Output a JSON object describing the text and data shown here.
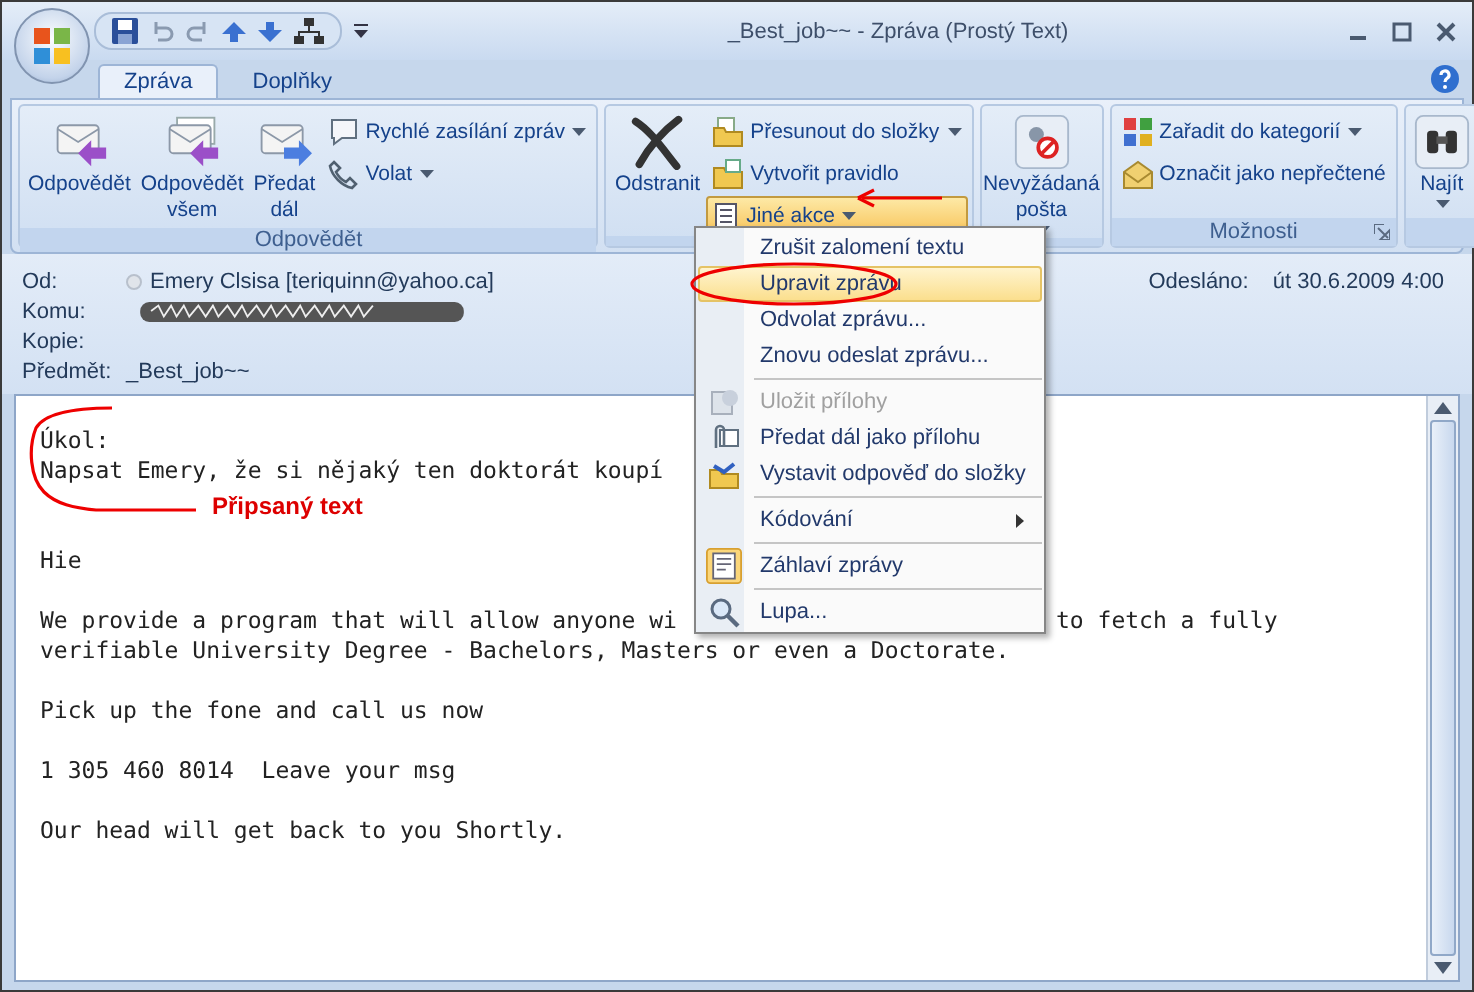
{
  "window": {
    "title": "_Best_job~~ - Zpráva (Prostý Text)"
  },
  "tabs": [
    {
      "label": "Zpráva",
      "selected": true
    },
    {
      "label": "Doplňky",
      "selected": false
    }
  ],
  "ribbon": {
    "groups": [
      {
        "label": "Odpovědět",
        "buttons": [
          {
            "label": "Odpovědět",
            "kind": "large",
            "dropdown": false,
            "pressed": false
          },
          {
            "label": "Odpovědět všem",
            "kind": "large",
            "dropdown": false,
            "pressed": false
          },
          {
            "label": "Předat dál",
            "kind": "large",
            "dropdown": false,
            "pressed": false
          },
          {
            "label": "Rychlé zasílání zpráv",
            "kind": "small",
            "dropdown": true,
            "pressed": false
          },
          {
            "label": "Volat",
            "kind": "small",
            "dropdown": true,
            "pressed": false
          }
        ]
      },
      {
        "buttons": [
          {
            "label": "Odstranit",
            "kind": "large",
            "dropdown": false,
            "pressed": false
          },
          {
            "label": "Přesunout do složky",
            "kind": "small",
            "dropdown": true,
            "pressed": false
          },
          {
            "label": "Vytvořit pravidlo",
            "kind": "small",
            "dropdown": false,
            "pressed": false
          },
          {
            "label": "Jiné akce",
            "kind": "small",
            "dropdown": true,
            "pressed": true
          }
        ]
      },
      {
        "buttons": [
          {
            "label": "Nevyžádaná pošta",
            "kind": "large",
            "dropdown": true,
            "pressed": false
          }
        ]
      },
      {
        "label": "Možnosti",
        "buttons": [
          {
            "label": "Zařadit do kategorií",
            "kind": "small",
            "dropdown": true,
            "pressed": false
          },
          {
            "label": "Označit jako nepřečtené",
            "kind": "small",
            "dropdown": false,
            "pressed": false
          }
        ]
      },
      {
        "buttons": [
          {
            "label": "Najít",
            "kind": "large",
            "dropdown": true,
            "pressed": false
          }
        ]
      }
    ]
  },
  "header": {
    "fields": [
      {
        "label": "Od:",
        "value": "Emery Clsisa  [teriquinn@yahoo.ca]",
        "kind": "sender"
      },
      {
        "label": "Komu:",
        "kind": "redacted"
      },
      {
        "label": "Kopie:",
        "kind": "empty"
      },
      {
        "label": "Předmět:",
        "value": "_Best_job~~",
        "kind": "text"
      }
    ],
    "sent_label": "Odesláno:",
    "sent_value": "út 30.6.2009 4:00"
  },
  "body": {
    "paragraphs": [
      {
        "lines": [
          {
            "text": "Úkol:"
          },
          {
            "text": "Napsat Emery, že si nějaký ten doktorát koupí"
          }
        ]
      },
      {
        "lines": [
          {
            "text": "Hie"
          }
        ]
      },
      {
        "lines": [
          {
            "text": "We provide a program that will allow anyone wi",
            "text_after_menu": "to fetch a fully"
          },
          {
            "text": "verifiable University Degree - Bachelors, Masters or even a Doctorate."
          }
        ]
      },
      {
        "lines": [
          {
            "text": "Pick up the fone and call us now"
          }
        ]
      },
      {
        "lines": [
          {
            "text": "1 305 460 8014  Leave your msg"
          }
        ]
      },
      {
        "lines": [
          {
            "text": "Our head will get back to you Shortly."
          }
        ]
      }
    ]
  },
  "menu": {
    "sections": [
      [
        {
          "label": "Zrušit zalomení textu",
          "kind": "plain",
          "disabled": false,
          "selected": false
        },
        {
          "label": "Upravit zprávu",
          "kind": "plain",
          "disabled": false,
          "selected": true
        },
        {
          "label": "Odvolat zprávu...",
          "kind": "plain",
          "disabled": false,
          "selected": false
        },
        {
          "label": "Znovu odeslat zprávu...",
          "kind": "plain",
          "disabled": false,
          "selected": false
        }
      ],
      [
        {
          "label": "Uložit přílohy",
          "kind": "icon",
          "disabled": true,
          "selected": false
        },
        {
          "label": "Předat dál jako přílohu",
          "kind": "icon",
          "disabled": false,
          "selected": false
        },
        {
          "label": "Vystavit odpověď do složky",
          "kind": "icon",
          "disabled": false,
          "selected": false
        }
      ],
      [
        {
          "label": "Kódování",
          "kind": "submenu",
          "disabled": false,
          "selected": false
        }
      ],
      [
        {
          "label": "Záhlaví zprávy",
          "kind": "icon",
          "disabled": false,
          "selected": false
        }
      ],
      [
        {
          "label": "Lupa...",
          "kind": "icon",
          "disabled": false,
          "selected": false
        }
      ]
    ]
  },
  "annotation": {
    "label": "Připsaný text"
  }
}
